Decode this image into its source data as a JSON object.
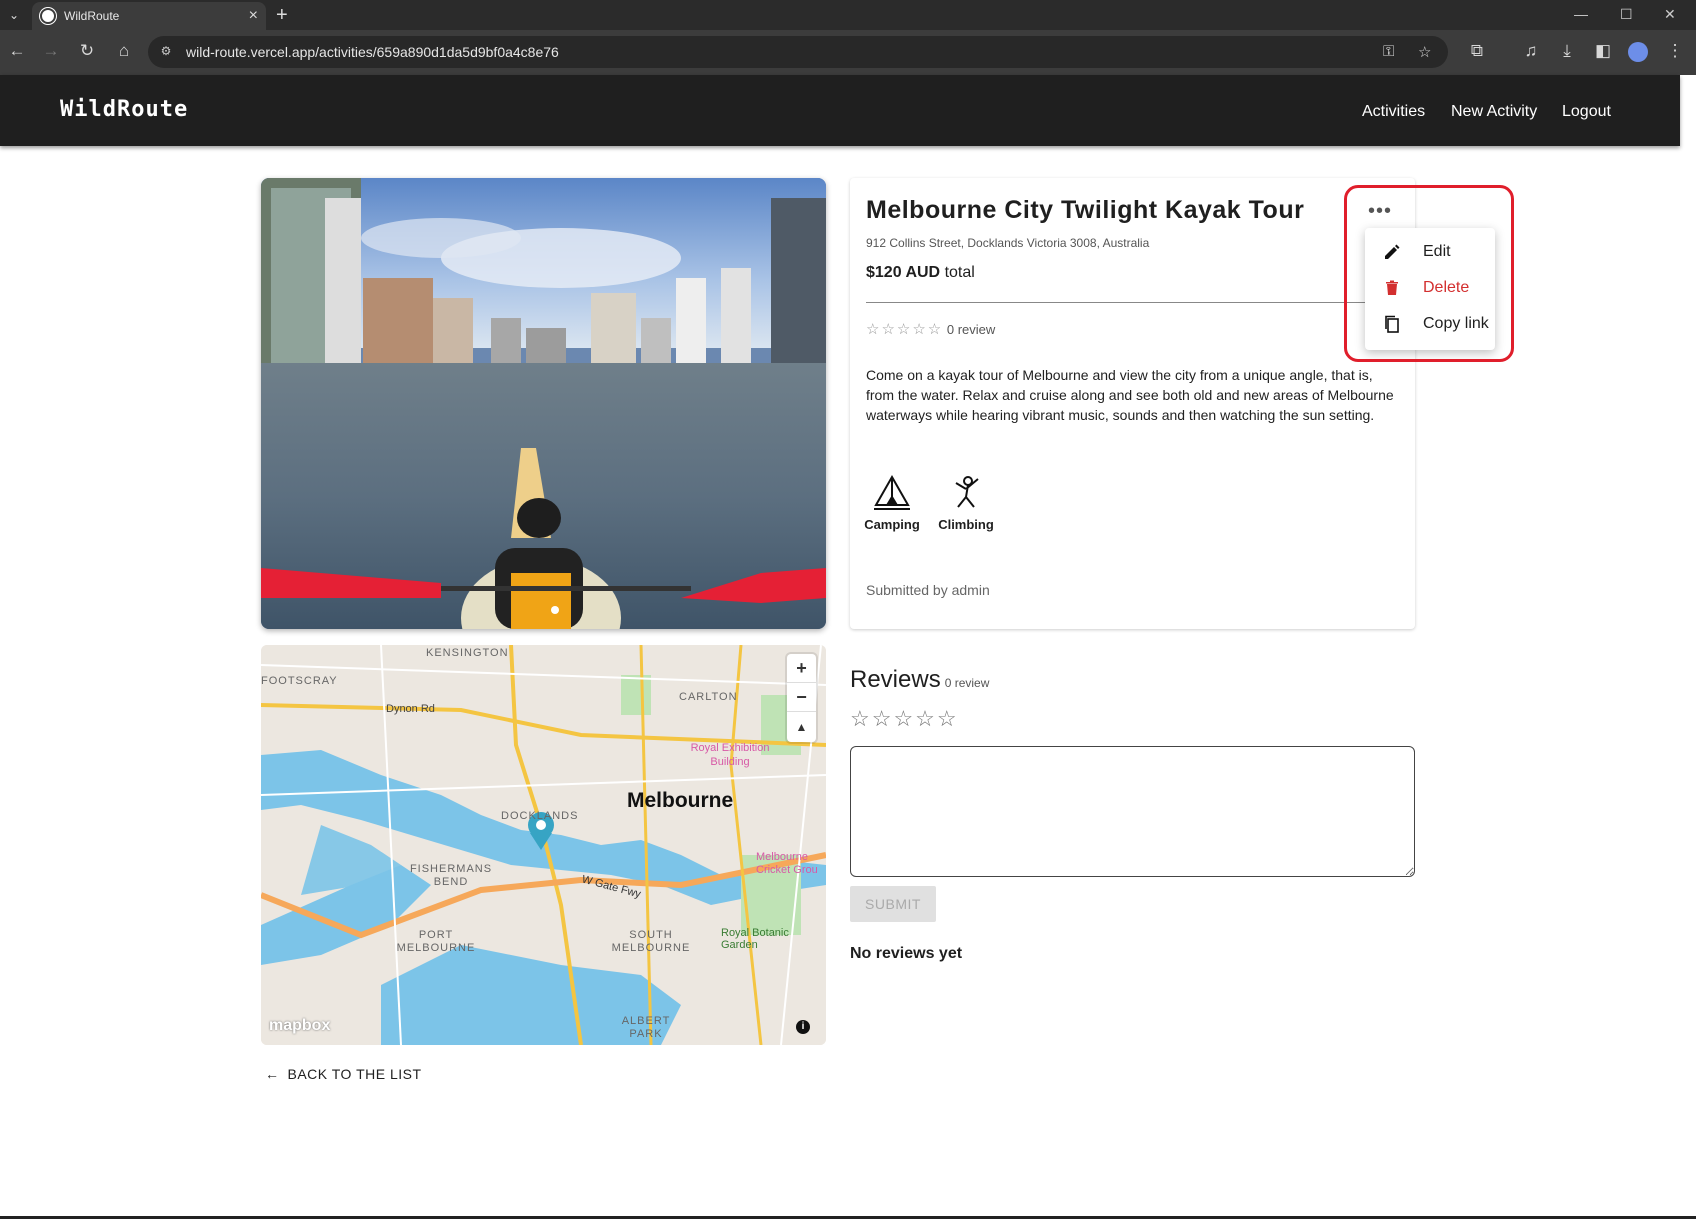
{
  "browser": {
    "tab_title": "WildRoute",
    "url": "wild-route.vercel.app/activities/659a890d1da5d9bf0a4c8e76"
  },
  "app": {
    "brand": "WildRoute",
    "nav": {
      "activities": "Activities",
      "new_activity": "New Activity",
      "logout": "Logout"
    }
  },
  "activity": {
    "title": "Melbourne City Twilight Kayak Tour",
    "address": "912 Collins Street, Docklands Victoria 3008, Australia",
    "price_amount": "$120 AUD",
    "price_suffix": "total",
    "rating_stars": "☆☆☆☆☆",
    "rating_count": "0 review",
    "description": "Come on a kayak tour of Melbourne and view the city from a unique angle, that is, from the water. Relax and cruise along and see both old and new areas of Melbourne waterways while hearing vibrant music, sounds and then watching the sun setting.",
    "amenities": [
      {
        "label": "Camping",
        "icon": "camping-icon"
      },
      {
        "label": "Climbing",
        "icon": "climbing-icon"
      }
    ],
    "submitted_by": "Submitted by admin"
  },
  "menu": {
    "more": "•••",
    "edit": "Edit",
    "delete": "Delete",
    "copy_link": "Copy link",
    "delete_color": "#d32f2f"
  },
  "map": {
    "labels": {
      "kensington": "KENSINGTON",
      "footscray": "FOOTSCRAY",
      "dynon": "Dynon Rd",
      "carlton": "CARLTON",
      "royal_exhibition": "Royal Exhibition Building",
      "melbourne": "Melbourne",
      "docklands": "DOCKLANDS",
      "fishermans_bend": "FISHERMANS BEND",
      "wgate": "W Gate Fwy",
      "port_melbourne": "PORT MELBOURNE",
      "south_melbourne": "SOUTH MELBOURNE",
      "royal_botanic": "Royal Botanic Garden",
      "albert_park": "ALBERT PARK",
      "melbourne_cricket": "Melbourne Cricket Grou",
      "mapbox": "mapbox"
    },
    "zoom_in": "+",
    "zoom_out": "−",
    "compass": "▲"
  },
  "back_link": "BACK TO THE LIST",
  "reviews": {
    "heading": "Reviews",
    "count": "0 review",
    "stars": "☆☆☆☆☆",
    "submit": "SUBMIT",
    "empty": "No reviews yet"
  }
}
